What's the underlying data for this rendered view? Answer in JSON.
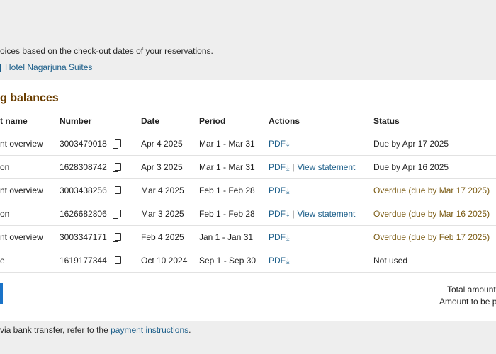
{
  "intro_text": "oices based on the check-out dates of your reservations.",
  "hotel_link": "Hotel Nagarjuna Suites",
  "section_title": "g balances",
  "columns": [
    "t name",
    "Number",
    "Date",
    "Period",
    "Actions",
    "Status"
  ],
  "rows": [
    {
      "name": "nt overview",
      "number": "3003479018",
      "date": "Apr 4 2025",
      "period": "Mar 1 - Mar 31",
      "pdf": "PDF",
      "view": "",
      "status": "Due by Apr 17 2025",
      "overdue": false
    },
    {
      "name": "on",
      "number": "1628308742",
      "date": "Apr 3 2025",
      "period": "Mar 1 - Mar 31",
      "pdf": "PDF",
      "view": "View statement",
      "status": "Due by Apr 16 2025",
      "overdue": false
    },
    {
      "name": "nt overview",
      "number": "3003438256",
      "date": "Mar 4 2025",
      "period": "Feb 1 - Feb 28",
      "pdf": "PDF",
      "view": "",
      "status": "Overdue (due by Mar 17 2025)",
      "overdue": true
    },
    {
      "name": "on",
      "number": "1626682806",
      "date": "Mar 3 2025",
      "period": "Feb 1 - Feb 28",
      "pdf": "PDF",
      "view": "View statement",
      "status": "Overdue (due by Mar 16 2025)",
      "overdue": true
    },
    {
      "name": "nt overview",
      "number": "3003347171",
      "date": "Feb 4 2025",
      "period": "Jan 1 - Jan 31",
      "pdf": "PDF",
      "view": "",
      "status": "Overdue (due by Feb 17 2025)",
      "overdue": true
    },
    {
      "name": "e",
      "number": "1619177344",
      "date": "Oct 10 2024",
      "period": "Sep 1 - Sep 30",
      "pdf": "PDF",
      "view": "",
      "status": "Not used",
      "overdue": false
    }
  ],
  "separator": "|",
  "total_label": "Total amount",
  "to_pay_label": "Amount to be p",
  "footer_prefix": " via bank transfer, refer to the ",
  "footer_link": "payment instructions",
  "footer_suffix": ".",
  "icons": {
    "copy": "copy-icon",
    "download": "download-icon"
  },
  "colors": {
    "link": "#1d5f8a",
    "title": "#6a3d00",
    "overdue": "#7a5a12",
    "button": "#1a73c8"
  }
}
